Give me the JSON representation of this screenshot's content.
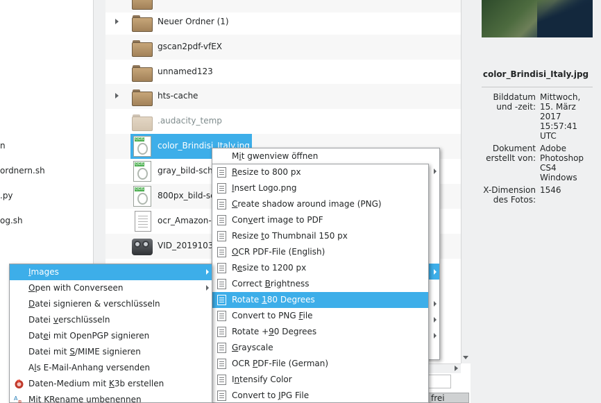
{
  "left_pane": {
    "items": [
      {
        "label": "n"
      },
      {
        "label": "ordnern.sh"
      },
      {
        "label": ".py"
      },
      {
        "label": "og.sh"
      }
    ]
  },
  "file_list": {
    "rows": [
      {
        "name": "",
        "kind": "folder",
        "expandable": false
      },
      {
        "name": "Neuer Ordner (1)",
        "kind": "folder",
        "expandable": true
      },
      {
        "name": "gscan2pdf-vfEX",
        "kind": "folder",
        "expandable": false
      },
      {
        "name": "unnamed123",
        "kind": "folder",
        "expandable": false
      },
      {
        "name": "hts-cache",
        "kind": "folder",
        "expandable": true
      },
      {
        "name": ".audacity_temp",
        "kind": "folder-hidden",
        "expandable": false
      },
      {
        "name": "color_Brindisi_Italy.jpg",
        "kind": "image",
        "selected": true
      },
      {
        "name": "gray_bild-sch",
        "kind": "image"
      },
      {
        "name": "800px_bild-sc",
        "kind": "image"
      },
      {
        "name": "ocr_Amazon-",
        "kind": "text"
      },
      {
        "name": "VID_2019103",
        "kind": "video"
      }
    ]
  },
  "info_panel": {
    "title": "color_Brindisi_Italy.jpg",
    "fields": [
      {
        "label_lines": [
          "Bilddatum",
          "und -zeit:"
        ],
        "value_lines": [
          "Mittwoch,",
          "15. März",
          "2017",
          "15:57:41",
          "UTC"
        ]
      },
      {
        "label_lines": [
          "Dokument",
          "erstellt von:"
        ],
        "value_lines": [
          "Adobe",
          "Photoshop",
          "CS4",
          "Windows"
        ]
      },
      {
        "label_lines": [
          "X-Dimension",
          "des Fotos:"
        ],
        "value_lines": [
          "1546"
        ]
      }
    ]
  },
  "status": {
    "free_label": "frei"
  },
  "context_menu": {
    "header": {
      "prefix": "M",
      "accel": "i",
      "rest": "t gwenview öffnen"
    }
  },
  "images_submenu": {
    "items": [
      {
        "pre": "",
        "accel": "R",
        "post": "esize to 800 px",
        "active": false
      },
      {
        "pre": "",
        "accel": "I",
        "post": "nsert Logo.png",
        "active": false
      },
      {
        "pre": "",
        "accel": "C",
        "post": "reate shadow around image (PNG)",
        "active": false
      },
      {
        "pre": "Con",
        "accel": "v",
        "post": "ert image to PDF",
        "active": false
      },
      {
        "pre": "Resize ",
        "accel": "t",
        "post": "o Thumbnail 150 px",
        "active": false
      },
      {
        "pre": "",
        "accel": "O",
        "post": "CR PDF-File (English)",
        "active": false
      },
      {
        "pre": "R",
        "accel": "e",
        "post": "size to 1200 px",
        "active": false
      },
      {
        "pre": "Correct ",
        "accel": "B",
        "post": "rightness",
        "active": false
      },
      {
        "pre": "Rotate ",
        "accel": "1",
        "post": "80 Degrees",
        "active": true
      },
      {
        "pre": "Convert to PNG ",
        "accel": "F",
        "post": "ile",
        "active": false
      },
      {
        "pre": "Rotate +",
        "accel": "9",
        "post": "0 Degrees",
        "active": false
      },
      {
        "pre": "",
        "accel": "G",
        "post": "rayscale",
        "active": false
      },
      {
        "pre": "OCR ",
        "accel": "P",
        "post": "DF-File (German)",
        "active": false
      },
      {
        "pre": "I",
        "accel": "n",
        "post": "tensify Color",
        "active": false
      },
      {
        "pre": "Convert to ",
        "accel": "J",
        "post": "PG File",
        "active": false
      }
    ]
  },
  "main_menu": {
    "items": [
      {
        "pre": "",
        "accel": "I",
        "post": "mages",
        "submenu": true,
        "active": true,
        "icon": ""
      },
      {
        "pre": "",
        "accel": "O",
        "post": "pen with Converseen",
        "submenu": true,
        "active": false,
        "icon": ""
      },
      {
        "pre": "",
        "accel": "D",
        "post": "atei signieren & verschlüsseln",
        "submenu": false,
        "active": false,
        "icon": ""
      },
      {
        "pre": "Datei ",
        "accel": "v",
        "post": "erschlüsseln",
        "submenu": false,
        "active": false,
        "icon": ""
      },
      {
        "pre": "Dat",
        "accel": "e",
        "post": "i mit OpenPGP signieren",
        "submenu": false,
        "active": false,
        "icon": ""
      },
      {
        "pre": "Datei mit ",
        "accel": "S",
        "post": "/MIME signieren",
        "submenu": false,
        "active": false,
        "icon": ""
      },
      {
        "pre": "A",
        "accel": "l",
        "post": "s E-Mail-Anhang versenden",
        "submenu": false,
        "active": false,
        "icon": ""
      },
      {
        "pre": "Daten-Medium mit ",
        "accel": "K",
        "post": "3b erstellen",
        "submenu": false,
        "active": false,
        "icon": "k3b-icon"
      },
      {
        "pre": "Mit KRename umbenennen",
        "accel": "",
        "post": "",
        "submenu": false,
        "active": false,
        "icon": "krename-icon"
      }
    ]
  },
  "colors": {
    "selection": "#3daee9",
    "panel_bg": "#eff0f1",
    "text": "#232627"
  }
}
